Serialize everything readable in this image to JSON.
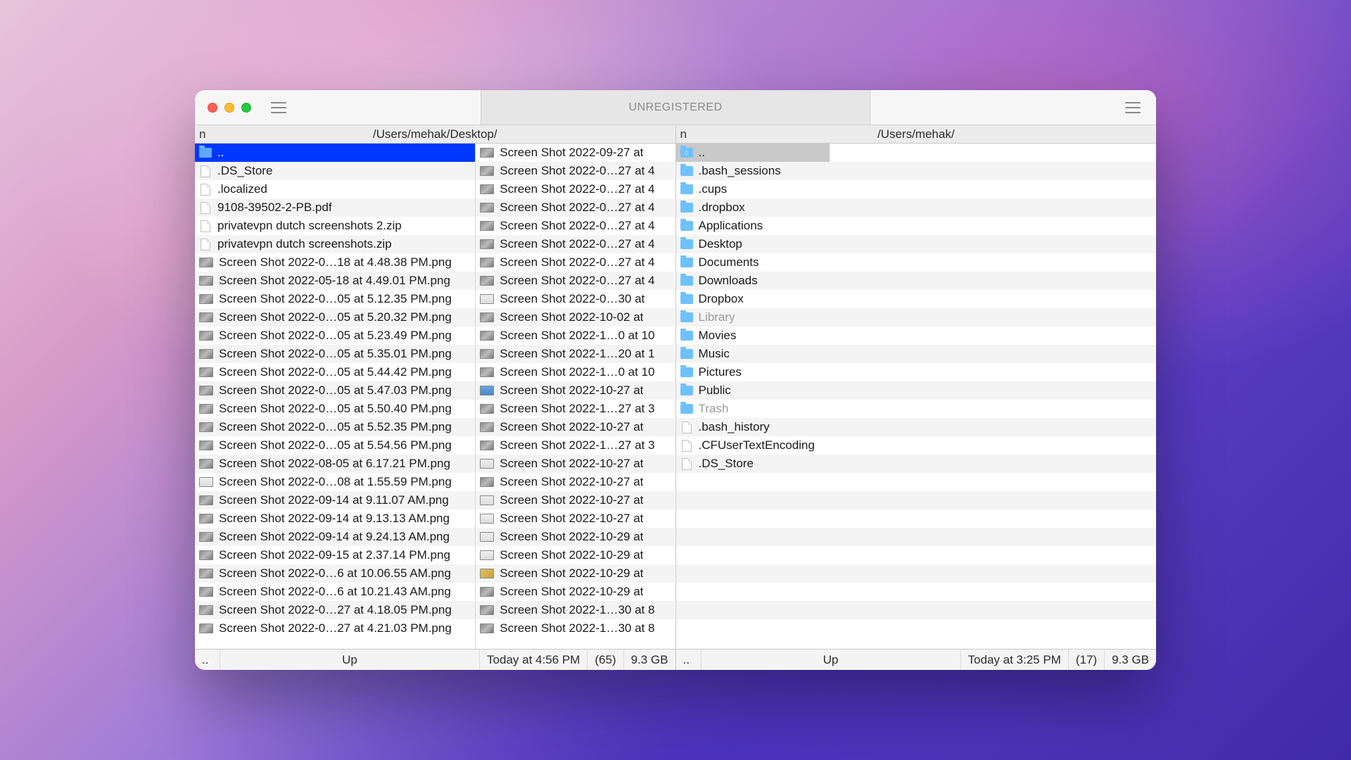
{
  "titlebar": {
    "center_label": "UNREGISTERED"
  },
  "left_pane": {
    "header_n": "n",
    "path": "/Users/mehak/Desktop/",
    "col1": [
      {
        "name": "..",
        "icon": "folder",
        "selected": "blue"
      },
      {
        "name": ".DS_Store",
        "icon": "file"
      },
      {
        "name": ".localized",
        "icon": "file"
      },
      {
        "name": "9108-39502-2-PB.pdf",
        "icon": "file"
      },
      {
        "name": "privatevpn dutch screenshots 2.zip",
        "icon": "file"
      },
      {
        "name": "privatevpn dutch screenshots.zip",
        "icon": "file"
      },
      {
        "name": "Screen Shot 2022-0…18 at 4.48.38 PM.png",
        "icon": "thumb"
      },
      {
        "name": "Screen Shot 2022-05-18 at 4.49.01 PM.png",
        "icon": "thumb"
      },
      {
        "name": "Screen Shot 2022-0…05 at 5.12.35 PM.png",
        "icon": "thumb"
      },
      {
        "name": "Screen Shot 2022-0…05 at 5.20.32 PM.png",
        "icon": "thumb"
      },
      {
        "name": "Screen Shot 2022-0…05 at 5.23.49 PM.png",
        "icon": "thumb"
      },
      {
        "name": "Screen Shot 2022-0…05 at 5.35.01 PM.png",
        "icon": "thumb"
      },
      {
        "name": "Screen Shot 2022-0…05 at 5.44.42 PM.png",
        "icon": "thumb"
      },
      {
        "name": "Screen Shot 2022-0…05 at 5.47.03 PM.png",
        "icon": "thumb"
      },
      {
        "name": "Screen Shot 2022-0…05 at 5.50.40 PM.png",
        "icon": "thumb"
      },
      {
        "name": "Screen Shot 2022-0…05 at 5.52.35 PM.png",
        "icon": "thumb"
      },
      {
        "name": "Screen Shot 2022-0…05 at 5.54.56 PM.png",
        "icon": "thumb"
      },
      {
        "name": "Screen Shot 2022-08-05 at 6.17.21 PM.png",
        "icon": "thumb"
      },
      {
        "name": "Screen Shot 2022-0…08 at 1.55.59 PM.png",
        "icon": "thumb light"
      },
      {
        "name": "Screen Shot 2022-09-14 at 9.11.07 AM.png",
        "icon": "thumb"
      },
      {
        "name": "Screen Shot 2022-09-14 at 9.13.13 AM.png",
        "icon": "thumb"
      },
      {
        "name": "Screen Shot 2022-09-14 at 9.24.13 AM.png",
        "icon": "thumb"
      },
      {
        "name": "Screen Shot 2022-09-15 at 2.37.14 PM.png",
        "icon": "thumb"
      },
      {
        "name": "Screen Shot 2022-0…6 at 10.06.55 AM.png",
        "icon": "thumb"
      },
      {
        "name": "Screen Shot 2022-0…6 at 10.21.43 AM.png",
        "icon": "thumb"
      },
      {
        "name": "Screen Shot 2022-0…27 at 4.18.05 PM.png",
        "icon": "thumb"
      },
      {
        "name": "Screen Shot 2022-0…27 at 4.21.03 PM.png",
        "icon": "thumb"
      }
    ],
    "col2": [
      {
        "name": "Screen Shot 2022-09-27 at",
        "icon": "thumb"
      },
      {
        "name": "Screen Shot 2022-0…27 at 4",
        "icon": "thumb"
      },
      {
        "name": "Screen Shot 2022-0…27 at 4",
        "icon": "thumb"
      },
      {
        "name": "Screen Shot 2022-0…27 at 4",
        "icon": "thumb"
      },
      {
        "name": "Screen Shot 2022-0…27 at 4",
        "icon": "thumb"
      },
      {
        "name": "Screen Shot 2022-0…27 at 4",
        "icon": "thumb"
      },
      {
        "name": "Screen Shot 2022-0…27 at 4",
        "icon": "thumb"
      },
      {
        "name": "Screen Shot 2022-0…27 at 4",
        "icon": "thumb"
      },
      {
        "name": "Screen Shot 2022-0…30 at",
        "icon": "thumb light"
      },
      {
        "name": "Screen Shot 2022-10-02 at",
        "icon": "thumb"
      },
      {
        "name": "Screen Shot 2022-1…0 at 10",
        "icon": "thumb"
      },
      {
        "name": "Screen Shot 2022-1…20 at 1",
        "icon": "thumb"
      },
      {
        "name": "Screen Shot 2022-1…0 at 10",
        "icon": "thumb"
      },
      {
        "name": "Screen Shot 2022-10-27 at",
        "icon": "thumb blue"
      },
      {
        "name": "Screen Shot 2022-1…27 at 3",
        "icon": "thumb"
      },
      {
        "name": "Screen Shot 2022-10-27 at",
        "icon": "thumb"
      },
      {
        "name": "Screen Shot 2022-1…27 at 3",
        "icon": "thumb"
      },
      {
        "name": "Screen Shot 2022-10-27 at",
        "icon": "thumb light"
      },
      {
        "name": "Screen Shot 2022-10-27 at",
        "icon": "thumb"
      },
      {
        "name": "Screen Shot 2022-10-27 at",
        "icon": "thumb light"
      },
      {
        "name": "Screen Shot 2022-10-27 at",
        "icon": "thumb light"
      },
      {
        "name": "Screen Shot 2022-10-29 at",
        "icon": "thumb light"
      },
      {
        "name": "Screen Shot 2022-10-29 at",
        "icon": "thumb light"
      },
      {
        "name": "Screen Shot 2022-10-29 at",
        "icon": "thumb yellow"
      },
      {
        "name": "Screen Shot 2022-10-29 at",
        "icon": "thumb"
      },
      {
        "name": "Screen Shot 2022-1…30 at 8",
        "icon": "thumb"
      },
      {
        "name": "Screen Shot 2022-1…30 at 8",
        "icon": "thumb"
      }
    ],
    "status": {
      "dots": "..",
      "up": "Up",
      "time": "Today at 4:56 PM",
      "count": "(65)",
      "size": "9.3 GB"
    }
  },
  "right_pane": {
    "header_n": "n",
    "path": "/Users/mehak/",
    "col1": [
      {
        "name": "..",
        "icon": "folder home",
        "selected": "grey"
      },
      {
        "name": ".bash_sessions",
        "icon": "folder"
      },
      {
        "name": ".cups",
        "icon": "folder"
      },
      {
        "name": ".dropbox",
        "icon": "folder"
      },
      {
        "name": "Applications",
        "icon": "folder"
      },
      {
        "name": "Desktop",
        "icon": "folder"
      },
      {
        "name": "Documents",
        "icon": "folder"
      },
      {
        "name": "Downloads",
        "icon": "folder"
      },
      {
        "name": "Dropbox",
        "icon": "folder"
      },
      {
        "name": "Library",
        "icon": "folder",
        "dim": true
      },
      {
        "name": "Movies",
        "icon": "folder"
      },
      {
        "name": "Music",
        "icon": "folder"
      },
      {
        "name": "Pictures",
        "icon": "folder"
      },
      {
        "name": "Public",
        "icon": "folder"
      },
      {
        "name": "Trash",
        "icon": "folder",
        "dim": true
      },
      {
        "name": ".bash_history",
        "icon": "file"
      },
      {
        "name": ".CFUserTextEncoding",
        "icon": "file"
      },
      {
        "name": ".DS_Store",
        "icon": "file"
      }
    ],
    "blank_rows": 9,
    "status": {
      "dots": "..",
      "up": "Up",
      "time": "Today at 3:25 PM",
      "count": "(17)",
      "size": "9.3 GB"
    }
  }
}
